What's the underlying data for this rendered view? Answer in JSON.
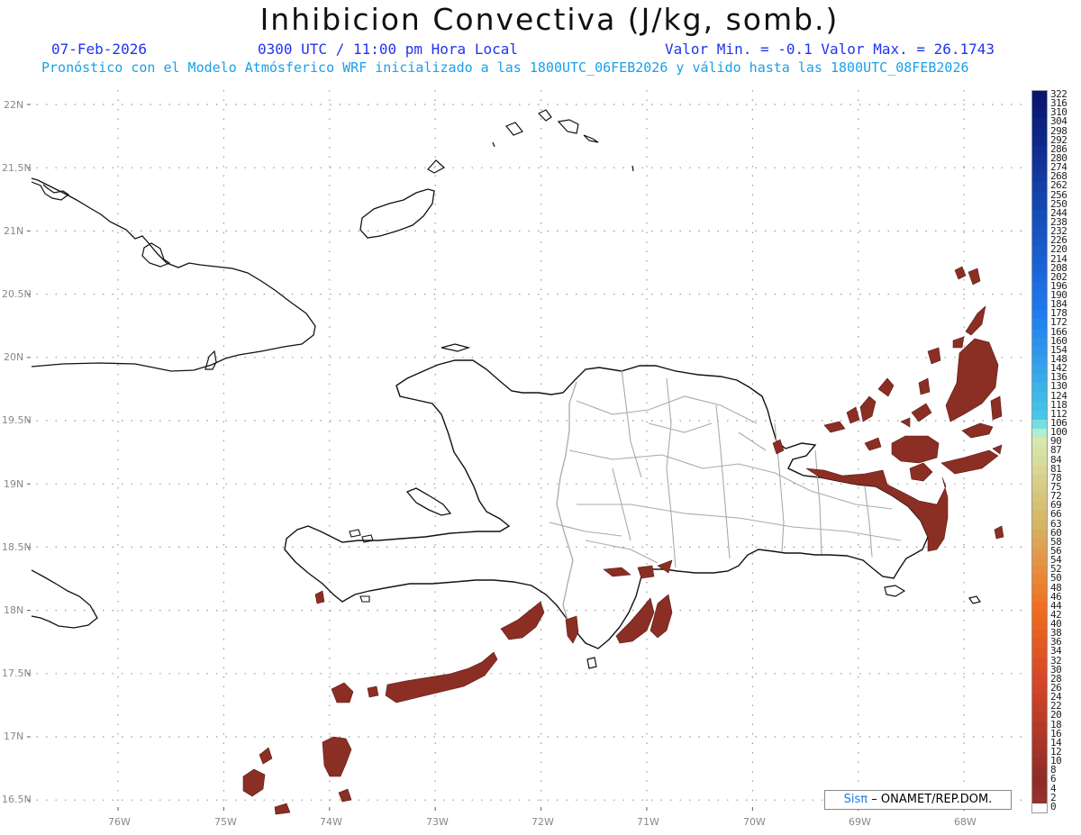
{
  "header": {
    "title": "Inhibicion Convectiva (J/kg, somb.)",
    "date": "07-Feb-2026",
    "time": "0300 UTC / 11:00 pm Hora Local",
    "min_max": "Valor Min. = -0.1  Valor Max. = 26.1743",
    "forecast_info": "Pronóstico con el Modelo Atmósferico WRF inicializado a las 1800UTC_06FEB2026 y válido hasta las  1800UTC_08FEB2026"
  },
  "axes": {
    "lat_labels": [
      "22N",
      "21.5N",
      "21N",
      "20.5N",
      "20N",
      "19.5N",
      "19N",
      "18.5N",
      "18N",
      "17.5N",
      "17N",
      "16.5N"
    ],
    "lon_labels": [
      "76W",
      "75W",
      "74W",
      "73W",
      "72W",
      "71W",
      "70W",
      "69W",
      "68W"
    ]
  },
  "legend": {
    "labels": [
      "322",
      "316",
      "310",
      "304",
      "298",
      "292",
      "286",
      "280",
      "274",
      "268",
      "262",
      "256",
      "250",
      "244",
      "238",
      "232",
      "226",
      "220",
      "214",
      "208",
      "202",
      "196",
      "190",
      "184",
      "178",
      "172",
      "166",
      "160",
      "154",
      "148",
      "142",
      "136",
      "130",
      "124",
      "118",
      "112",
      "106",
      "100",
      "90",
      "87",
      "84",
      "81",
      "78",
      "75",
      "72",
      "69",
      "66",
      "63",
      "60",
      "58",
      "56",
      "54",
      "52",
      "50",
      "48",
      "46",
      "44",
      "42",
      "40",
      "38",
      "36",
      "34",
      "32",
      "30",
      "28",
      "26",
      "24",
      "22",
      "20",
      "18",
      "16",
      "14",
      "12",
      "10",
      "8",
      "6",
      "4",
      "2",
      "0"
    ]
  },
  "credit": {
    "sis": "Sisπ",
    "org": "– ONAMET/REP.DOM."
  },
  "colors": {
    "shade": "#8b2e24",
    "coast": "#111111",
    "border": "#aaaaaa"
  }
}
